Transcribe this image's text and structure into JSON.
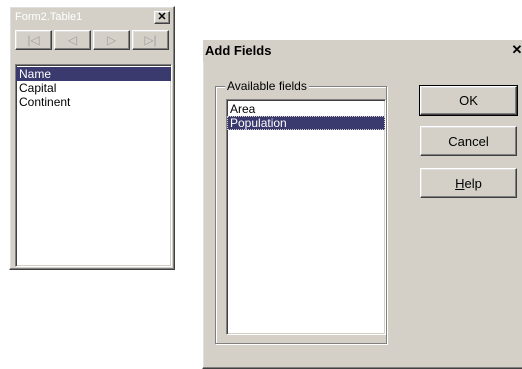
{
  "table_window": {
    "title": "Form2.Table1",
    "close_label": "✕",
    "nav": [
      {
        "name": "first-record-button",
        "glyph": "|◁"
      },
      {
        "name": "prior-record-button",
        "glyph": "◁"
      },
      {
        "name": "next-record-button",
        "glyph": "▷"
      },
      {
        "name": "last-record-button",
        "glyph": "▷|"
      }
    ],
    "fields": [
      "Name",
      "Capital",
      "Continent"
    ],
    "selected_field": "Name"
  },
  "dialog": {
    "title": "Add Fields",
    "close_label": "✕",
    "group_label": "Available fields",
    "available_fields": [
      "Area",
      "Population"
    ],
    "selected_field": "Population",
    "ok_label": "OK",
    "cancel_label": "Cancel",
    "help_label": "Help"
  },
  "colors": {
    "face": "#d4d0c8",
    "selection": "#3a3a6e"
  }
}
